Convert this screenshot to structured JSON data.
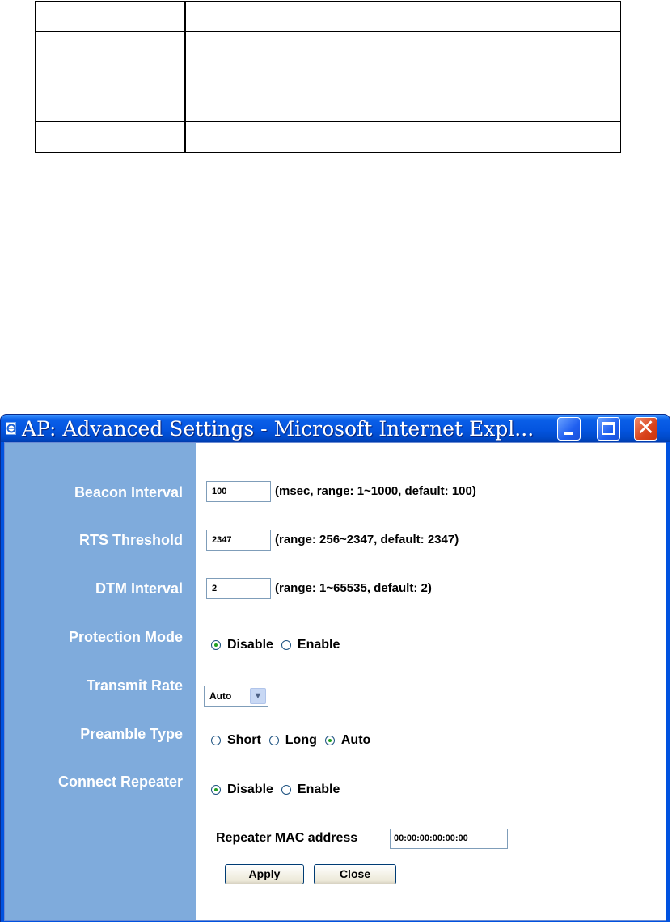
{
  "window": {
    "title": "AP: Advanced Settings - Microsoft Internet Expl...",
    "close_glyph": "✕"
  },
  "form": {
    "beacon_interval": {
      "label": "Beacon Interval",
      "value": "100",
      "hint": "(msec, range: 1~1000, default: 100)"
    },
    "rts_threshold": {
      "label": "RTS Threshold",
      "value": "2347",
      "hint": "(range: 256~2347, default: 2347)"
    },
    "dtm_interval": {
      "label": "DTM Interval",
      "value": "2",
      "hint": "(range: 1~65535, default: 2)"
    },
    "protection_mode": {
      "label": "Protection Mode",
      "options": [
        "Disable",
        "Enable"
      ],
      "selected": "Disable"
    },
    "transmit_rate": {
      "label": "Transmit Rate",
      "value": "Auto"
    },
    "preamble_type": {
      "label": "Preamble Type",
      "options": [
        "Short",
        "Long",
        "Auto"
      ],
      "selected": "Auto"
    },
    "connect_repeater": {
      "label": "Connect Repeater",
      "options": [
        "Disable",
        "Enable"
      ],
      "selected": "Disable"
    },
    "repeater_mac": {
      "label": "Repeater MAC address",
      "value": "00:00:00:00:00:00"
    }
  },
  "buttons": {
    "apply": "Apply",
    "close": "Close"
  },
  "colors": {
    "label_column": "#7fabdc",
    "titlebar": "#0455e0",
    "radio_dot": "#21a121"
  }
}
